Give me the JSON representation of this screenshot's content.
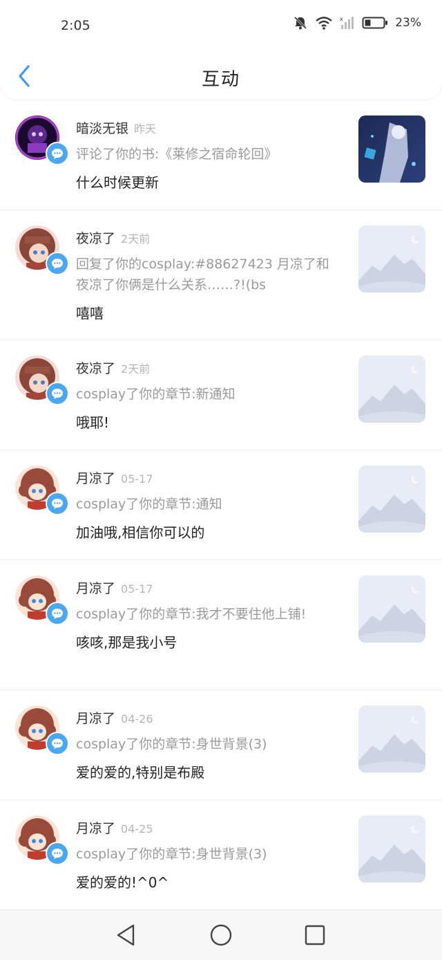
{
  "status": {
    "time": "2:05",
    "battery": "23%"
  },
  "header": {
    "title": "互动"
  },
  "items": [
    {
      "name": "暗淡无银",
      "time": "昨天",
      "action": "评论了你的书:《莱修之宿命轮回》",
      "message": "什么时候更新"
    },
    {
      "name": "夜凉了",
      "time": "2天前",
      "action": "回复了你的cosplay:#88627423 月凉了和夜凉了你俩是什么关系……?!(bs",
      "message": "嘻嘻"
    },
    {
      "name": "夜凉了",
      "time": "2天前",
      "action": "cosplay了你的章节:新通知",
      "message": "哦耶!"
    },
    {
      "name": "月凉了",
      "time": "05-17",
      "action": "cosplay了你的章节:通知",
      "message": "加油哦,相信你可以的"
    },
    {
      "name": "月凉了",
      "time": "05-17",
      "action": "cosplay了你的章节:我才不要住他上铺!",
      "message": "咳咳,那是我小号"
    },
    {
      "name": "月凉了",
      "time": "04-26",
      "action": "cosplay了你的章节:身世背景(3)",
      "message": "爱的爱的,特别是布殿"
    },
    {
      "name": "月凉了",
      "time": "04-25",
      "action": "cosplay了你的章节:身世背景(3)",
      "message": "爱的爱的!^0^"
    }
  ],
  "icons": {
    "back": "chevron-left-icon",
    "badge": "chat-bubble-icon",
    "nav_back": "triangle-back-icon",
    "nav_home": "circle-home-icon",
    "nav_recent": "square-recent-icon"
  },
  "colors": {
    "accent": "#4aa8f0"
  }
}
